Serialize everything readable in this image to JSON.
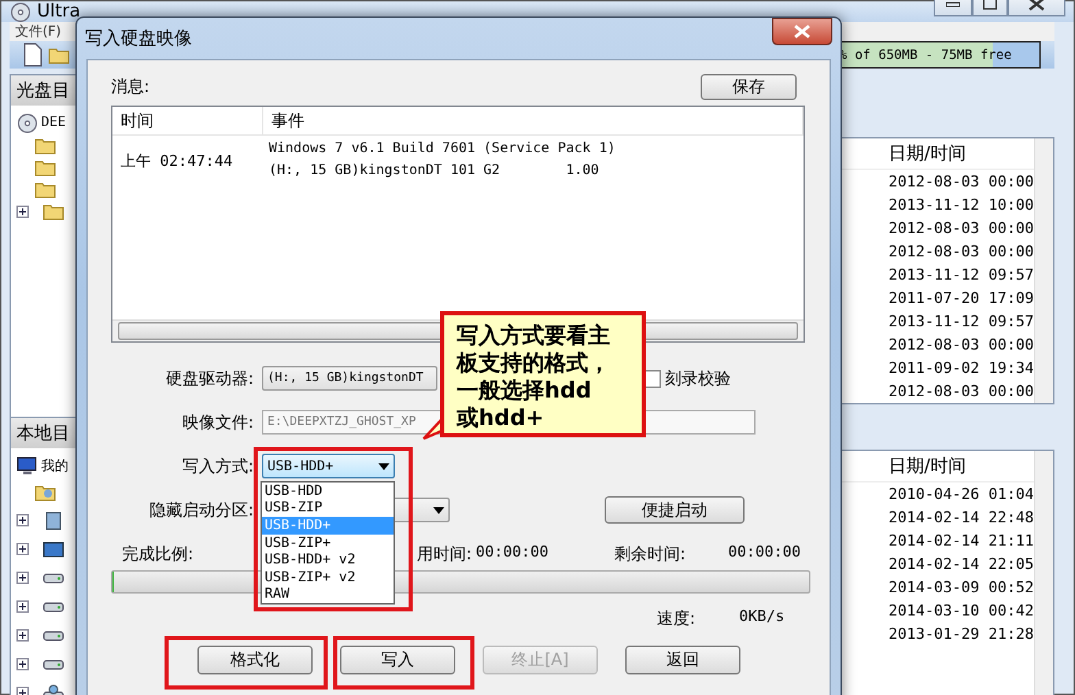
{
  "main_window": {
    "title": "Ultra",
    "menu": [
      "文件(F)"
    ],
    "capacity_text": "% of 650MB - 75MB free",
    "upper_pane": {
      "heading": "光盘目",
      "tree": [
        {
          "label": "DEE",
          "kind": "disc",
          "children": [
            {
              "kind": "folder",
              "has_children": false
            },
            {
              "kind": "folder",
              "has_children": false
            },
            {
              "kind": "folder",
              "has_children": false
            },
            {
              "kind": "folder",
              "has_children": true
            }
          ]
        }
      ],
      "column": "日期/时间",
      "rows": [
        "2012-08-03 00:00",
        "2013-11-12 10:00",
        "2012-08-03 00:00",
        "2012-08-03 00:00",
        "2013-11-12 09:57",
        "2011-07-20 17:09",
        "2013-11-12 09:57",
        "2012-08-03 00:00",
        "2011-09-02 19:34",
        "2012-08-03 00:00"
      ]
    },
    "lower_pane": {
      "heading": "本地目",
      "tree": [
        {
          "label": "我的",
          "kind": "computer",
          "children": [
            {
              "kind": "docs",
              "has_children": false
            },
            {
              "kind": "box",
              "has_children": true
            },
            {
              "kind": "desktop",
              "has_children": true
            },
            {
              "kind": "drive",
              "has_children": true
            },
            {
              "kind": "drive",
              "has_children": true
            },
            {
              "kind": "drive",
              "has_children": true
            },
            {
              "kind": "drive",
              "has_children": true
            },
            {
              "kind": "netdrive",
              "has_children": true
            }
          ]
        }
      ],
      "column": "日期/时间",
      "rows": [
        "2010-04-26 01:04",
        "2014-02-14 22:48",
        "2014-02-14 21:11",
        "2014-02-14 22:05",
        "2014-03-09 00:52",
        "2014-03-10 00:42",
        "2013-01-29 21:28"
      ]
    }
  },
  "dialog": {
    "title": "写入硬盘映像",
    "messages_label": "消息:",
    "save_button": "保存",
    "log": {
      "columns": [
        "时间",
        "事件"
      ],
      "rows": [
        {
          "time": "上午 02:47:44",
          "event": [
            "Windows 7 v6.1 Build 7601 (Service Pack 1)",
            "(H:, 15 GB)kingstonDT 101 G2        1.00"
          ]
        }
      ]
    },
    "drive_label": "硬盘驱动器:",
    "drive_value": "(H:, 15 GB)kingstonDT",
    "verify": {
      "label": "刻录校验",
      "checked": false
    },
    "image_label": "映像文件:",
    "image_value": "E:\\DEEPXTZJ_GHOST_XP",
    "method_label": "写入方式:",
    "method_value": "USB-HDD+",
    "method_options": [
      {
        "label": "USB-HDD",
        "selected": false
      },
      {
        "label": "USB-ZIP",
        "selected": false
      },
      {
        "label": "USB-HDD+",
        "selected": true
      },
      {
        "label": "USB-ZIP+",
        "selected": false
      },
      {
        "label": "USB-HDD+ v2",
        "selected": false
      },
      {
        "label": "USB-ZIP+ v2",
        "selected": false
      },
      {
        "label": "RAW",
        "selected": false
      }
    ],
    "hidden_label": "隐藏启动分区:",
    "quick_boot_button": "便捷启动",
    "progress_label": "完成比例:",
    "elapsed_label": "用时间:",
    "elapsed_value": "00:00:00",
    "remaining_label": "剩余时间:",
    "remaining_value": "00:00:00",
    "progress": {
      "level": 0
    },
    "speed_label": "速度:",
    "speed_value": "0KB/s",
    "buttons": [
      {
        "label": "格式化",
        "disabled": false,
        "highlighted": true
      },
      {
        "label": "写入",
        "disabled": false,
        "highlighted": true
      },
      {
        "label": "终止[A]",
        "disabled": true,
        "highlighted": false
      },
      {
        "label": "返回",
        "disabled": false,
        "highlighted": false
      }
    ]
  },
  "callout": {
    "text": "写入方式要看主板支持的格式，一般选择hdd或hdd+"
  }
}
